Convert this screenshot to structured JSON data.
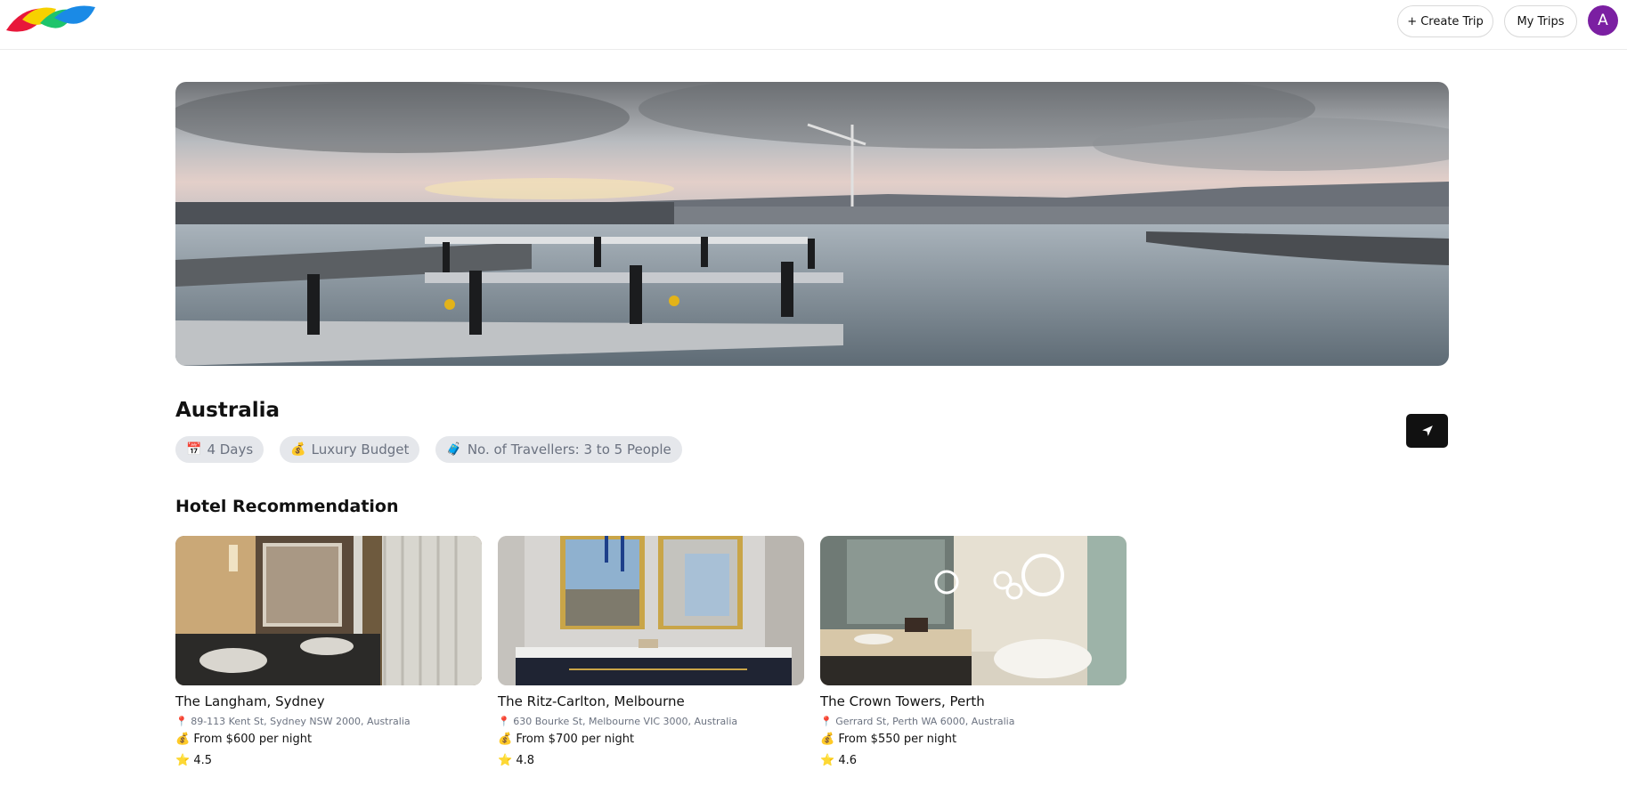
{
  "header": {
    "create_trip_label": "+ Create Trip",
    "my_trips_label": "My Trips",
    "avatar_initial": "A"
  },
  "trip": {
    "destination": "Australia",
    "chips": [
      {
        "icon": "📅",
        "label": "4 Days"
      },
      {
        "icon": "💰",
        "label": "Luxury Budget"
      },
      {
        "icon": "🧳",
        "label": "No. of Travellers: 3 to 5 People"
      }
    ],
    "share_icon": "send-icon"
  },
  "hotels": {
    "title": "Hotel Recommendation",
    "items": [
      {
        "name": "The Langham, Sydney",
        "address": "89-113 Kent St, Sydney NSW 2000, Australia",
        "price": "From $600 per night",
        "rating": "4.5"
      },
      {
        "name": "The Ritz-Carlton, Melbourne",
        "address": "630 Bourke St, Melbourne VIC 3000, Australia",
        "price": "From $700 per night",
        "rating": "4.8"
      },
      {
        "name": "The Crown Towers, Perth",
        "address": "Gerrard St, Perth WA 6000, Australia",
        "price": "From $550 per night",
        "rating": "4.6"
      }
    ]
  },
  "icons": {
    "price_icon": "💰",
    "rating_icon": "⭐",
    "address_icon": "📍"
  },
  "colors": {
    "avatar_bg": "#7b1fa2",
    "chip_bg": "#e5e7eb",
    "share_button_bg": "#111111",
    "logo_red": "#e8173a",
    "logo_yellow": "#f7d100",
    "logo_green": "#1ec46b",
    "logo_blue": "#1a8ae6"
  }
}
